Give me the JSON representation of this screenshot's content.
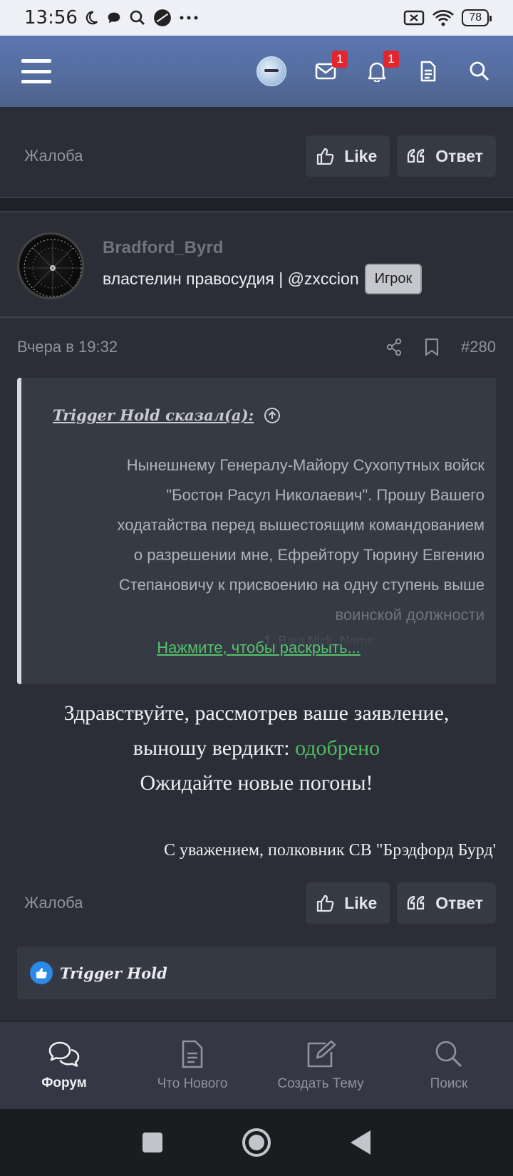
{
  "status_bar": {
    "time": "13:56",
    "battery": "78"
  },
  "header": {
    "messages_badge": "1",
    "alerts_badge": "1"
  },
  "post_prev": {
    "complaint_label": "Жалоба",
    "like_label": "Like",
    "reply_label": "Ответ"
  },
  "post": {
    "username": "Bradford_Byrd",
    "user_title": "властелин правосудия | @zxccion",
    "role_badge": "Игрок",
    "date": "Вчера в 19:32",
    "post_number": "#280",
    "quote": {
      "author": "Trigger Hold сказал(а):",
      "lines": [
        "Нынешнему Генералу-Майору Сухопутных войск",
        "\"Бостон Расул Николаевич\". Прошу Вашего",
        "ходатайства перед вышестоящим командованием",
        "о разрешении мне, Ефрейтору Тюрину Евгению",
        "Степановичу к присвоению на одну ступень выше",
        "воинской должности",
        "1. Ваш Nick_Name:"
      ],
      "expand_label": "Нажмите, чтобы раскрыть..."
    },
    "message": {
      "line1": "Здравствуйте, рассмотрев ваше заявление,",
      "line2_prefix": "выношу вердикт:",
      "line2_status": "одобрено",
      "line3": "Ожидайте новые погоны!"
    },
    "signature": "С уважением, полковник СВ \"Брэдфорд Бурд'",
    "complaint_label": "Жалоба",
    "like_label": "Like",
    "reply_label": "Ответ",
    "liked_by": "Trigger Hold"
  },
  "bottom_nav": [
    {
      "label": "Форум",
      "icon": "forum-icon",
      "active": true
    },
    {
      "label": "Что Нового",
      "icon": "document-icon",
      "active": false
    },
    {
      "label": "Создать Тему",
      "icon": "edit-icon",
      "active": false
    },
    {
      "label": "Поиск",
      "icon": "search-icon",
      "active": false
    }
  ],
  "colors": {
    "header": "#5b77b2",
    "approved": "#4dbb60",
    "expand_link": "#55c26b",
    "badge": "#e3252d",
    "background": "#2b2e37"
  }
}
